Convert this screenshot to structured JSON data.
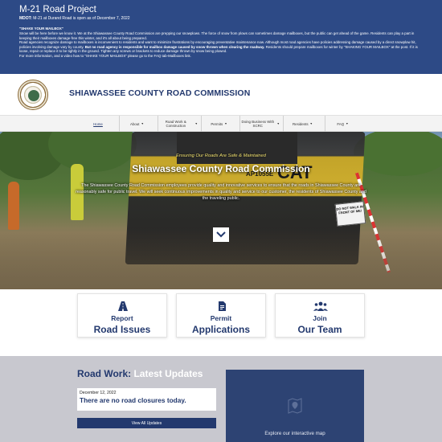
{
  "alert": {
    "title": "M-21 Road Project",
    "sub_bold": "MDOT:",
    "sub_rest": " M-21 at Durand Road is open as of December 7, 2022",
    "heading": "\"SHAKE YOUR MAILBOX\"",
    "p1": "Snow will be here before we know it. We at the Shiawassee County Road Commission are prepping our snowplows. The force of snow from plows can sometimes damage mailboxes, but the public can get ahead of the game. Residents can play a part in keeping their mailboxes damage-free this winter, and it's all about being prepared.",
    "p2_start": "Road agencies recognize damage to mailboxes is inconvenient to residents and want to minimize frustrations by encouraging preventative maintenance now. Although most road agencies have policies addressing damage caused by a direct snowplow hit, policies involving damage vary by county. ",
    "p2_bold": "But no road agency is responsible for mailbox damage caused by snow thrown when clearing the roadway.",
    "p2_end": " Residents should prepare mailboxes for winter by \"SHAKING YOUR MAILBOX\" at the post. If it is loose, repair or replace it to be tightly in the ground. Tighten any screws or brackets to reduce damage thrown by snow being plowed.",
    "p3": "For more information, and a video how to \"SHAKE YOUR MAILBOX\" please go to the FAQ tab-Mailboxes link."
  },
  "header": {
    "site_title": "SHIAWASSEE COUNTY ROAD COMMISSION"
  },
  "nav": {
    "items": [
      {
        "label": "Home"
      },
      {
        "label": "About",
        "caret": "▼"
      },
      {
        "label": "Road Work & Construction",
        "caret": "▼"
      },
      {
        "label": "Permits",
        "caret": "▼"
      },
      {
        "label": "Doing Business With SCRC",
        "caret": "▼"
      },
      {
        "label": "Residents",
        "caret": "▼"
      },
      {
        "label": "FAQ",
        "caret": "▼"
      }
    ]
  },
  "hero": {
    "kicker": "Ensuring Our Roads Are Safe & Maintained",
    "title": "Shiawassee County Road Commission",
    "description": "The Shiawassee County Road Commission employees provide quality and innovative services to ensure that the roads in Shiawassee County are reasonably safe for public travel. We will seek continuous improvements in quality and service to our customer, the residents of Shiawassee County and the traveling public.",
    "machine_id": "AP1055E",
    "brand": "CAT",
    "sign_text": "DO NOT WALK IN FRONT OF ME!"
  },
  "cards": [
    {
      "small": "Report",
      "big": "Road Issues",
      "icon": "road-icon"
    },
    {
      "small": "Permit",
      "big": "Applications",
      "icon": "document-icon"
    },
    {
      "small": "Join",
      "big": "Our Team",
      "icon": "team-icon"
    }
  ],
  "updates": {
    "title_main": "Road Work:",
    "title_highlight": " Latest Updates",
    "news_date": "December 12, 2022",
    "news_headline": "There are no road closures today.",
    "view_all": "View All Updates",
    "map_text": "Explore our interactive map"
  },
  "colors": {
    "brand_navy": "#23396e",
    "alert_blue": "#2d4a86",
    "updates_bg": "#c8c8cf",
    "map_bg": "#2d4373"
  }
}
